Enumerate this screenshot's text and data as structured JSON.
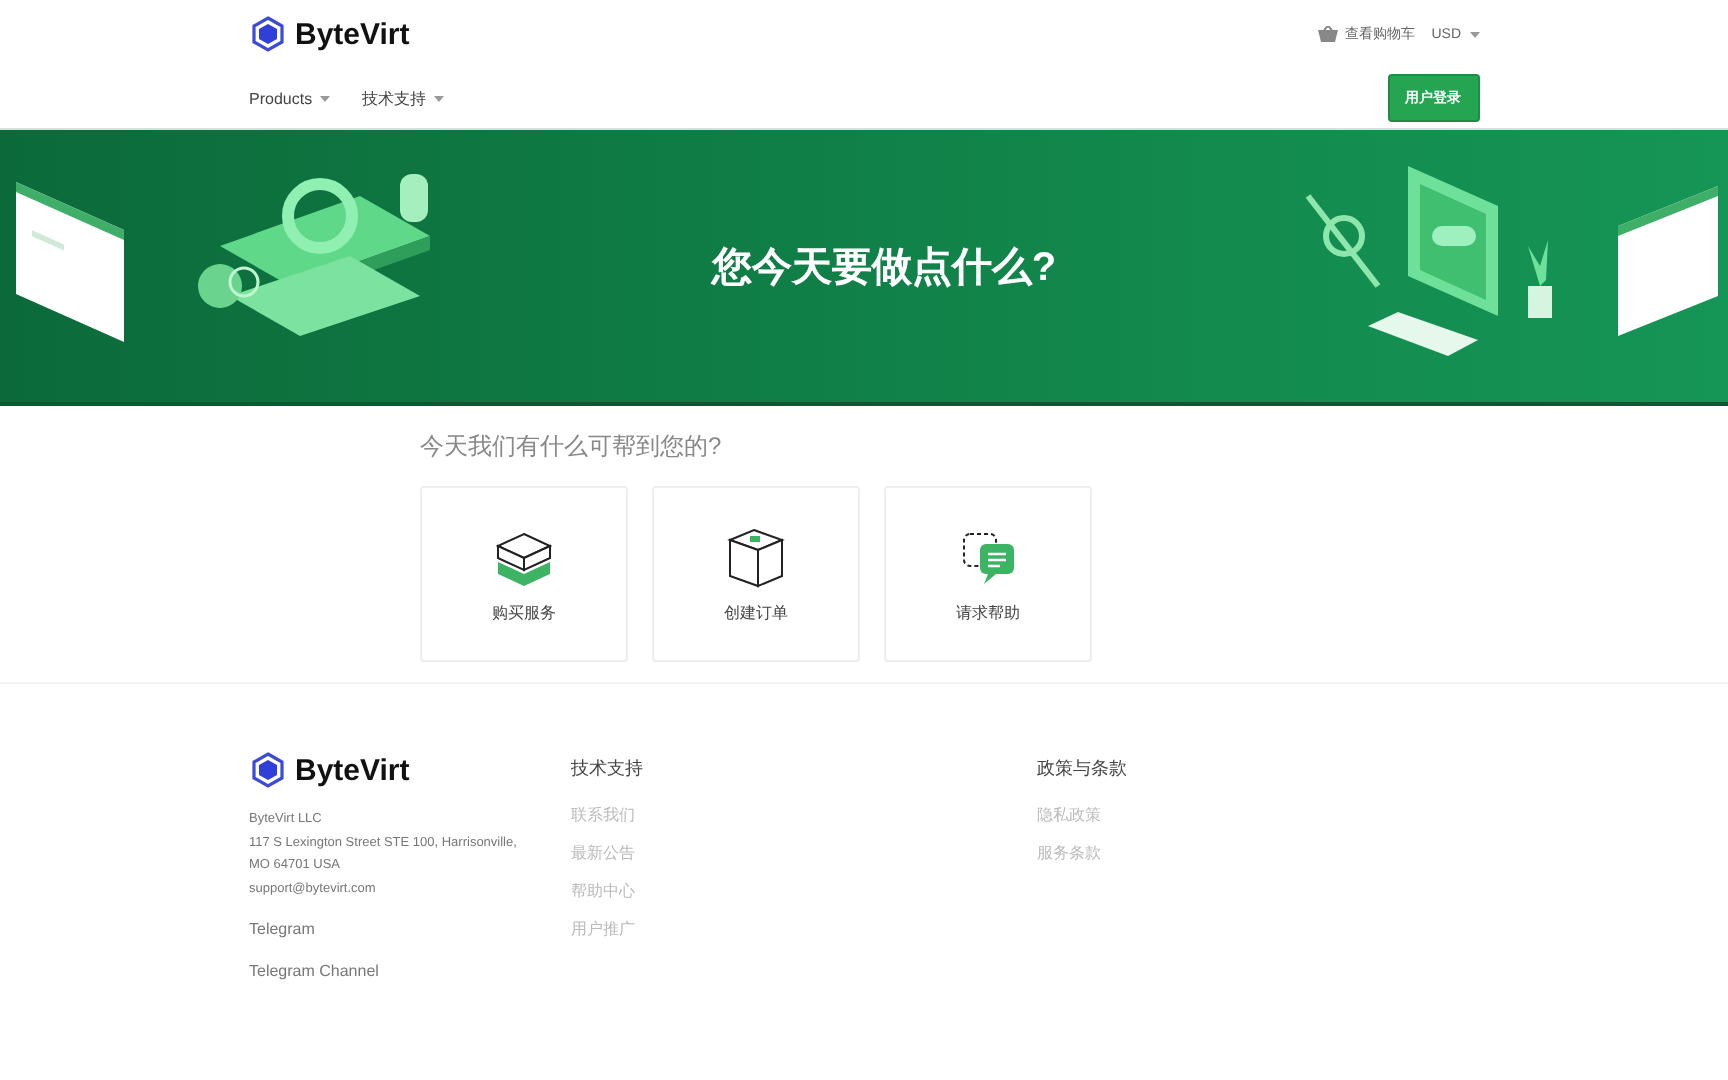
{
  "header": {
    "brand": "ByteVirt",
    "cart_link": "查看购物车",
    "currency": "USD",
    "nav": [
      {
        "label": "Products"
      },
      {
        "label": "技术支持"
      }
    ],
    "login_button": "用户登录"
  },
  "hero": {
    "title": "您今天要做点什么?"
  },
  "help": {
    "title": "今天我们有什么可帮到您的?",
    "cards": [
      {
        "kind": "buy",
        "label": "购买服务"
      },
      {
        "kind": "order",
        "label": "创建订单"
      },
      {
        "kind": "support",
        "label": "请求帮助"
      }
    ]
  },
  "footer": {
    "brand": "ByteVirt",
    "address": [
      "ByteVirt LLC",
      "117 S Lexington Street STE 100, Harrisonville,",
      "MO 64701 USA",
      "support@bytevirt.com"
    ],
    "links": [
      "Telegram",
      "Telegram Channel"
    ],
    "columns": [
      {
        "title": "技术支持",
        "items": [
          "联系我们",
          "最新公告",
          "帮助中心",
          "用户推广"
        ]
      },
      {
        "title": "政策与条款",
        "items": [
          "隐私政策",
          "服务条款"
        ]
      }
    ]
  }
}
